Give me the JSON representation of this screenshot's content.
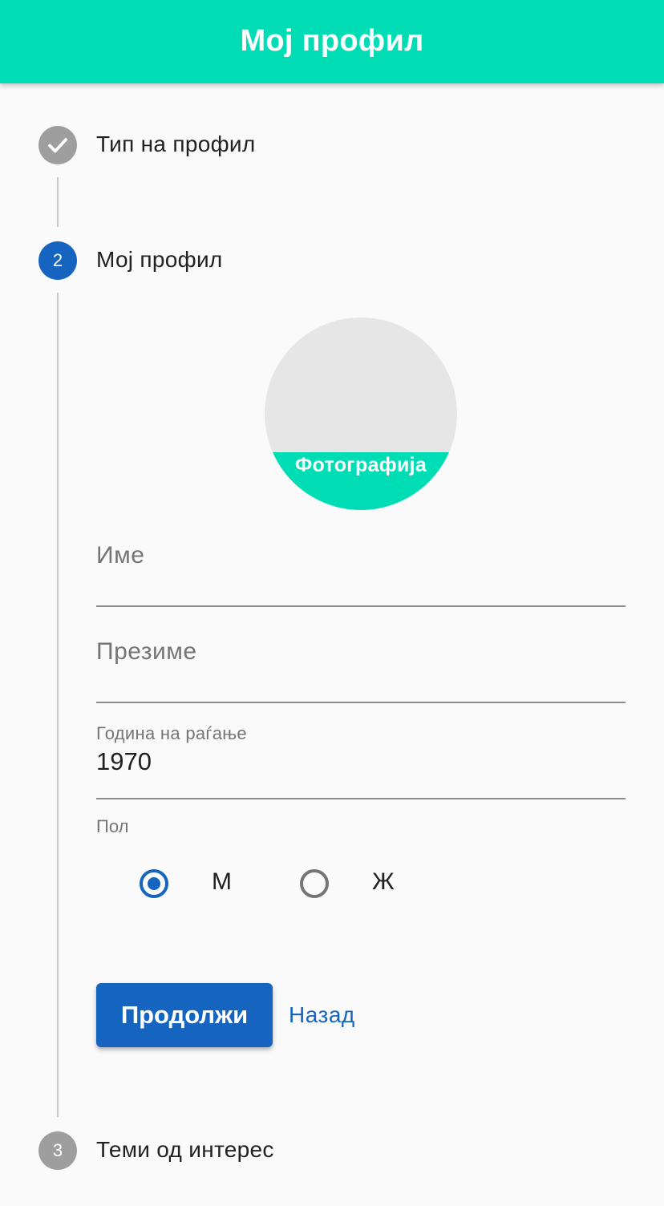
{
  "appbar": {
    "title": "Мој профил",
    "color": "#00ddb4"
  },
  "stepper": {
    "steps": [
      {
        "number": "1",
        "label": "Тип на профил",
        "state": "completed",
        "icon": "check-icon"
      },
      {
        "number": "2",
        "label": "Мој профил",
        "state": "active"
      },
      {
        "number": "3",
        "label": "Теми од интерес",
        "state": "pending"
      }
    ]
  },
  "form": {
    "photo": {
      "label": "Фотографија"
    },
    "first_name": {
      "placeholder": "Име",
      "value": ""
    },
    "last_name": {
      "placeholder": "Презиме",
      "value": ""
    },
    "birth_year": {
      "label": "Година на раѓање",
      "value": "1970"
    },
    "gender": {
      "label": "Пол",
      "options": [
        {
          "label": "М",
          "selected": true
        },
        {
          "label": "Ж",
          "selected": false
        }
      ]
    },
    "continue_label": "Продолжи",
    "back_label": "Назад"
  },
  "colors": {
    "primary": "#1565c0",
    "accent": "#00ddb4",
    "inactive": "#9e9e9e"
  }
}
